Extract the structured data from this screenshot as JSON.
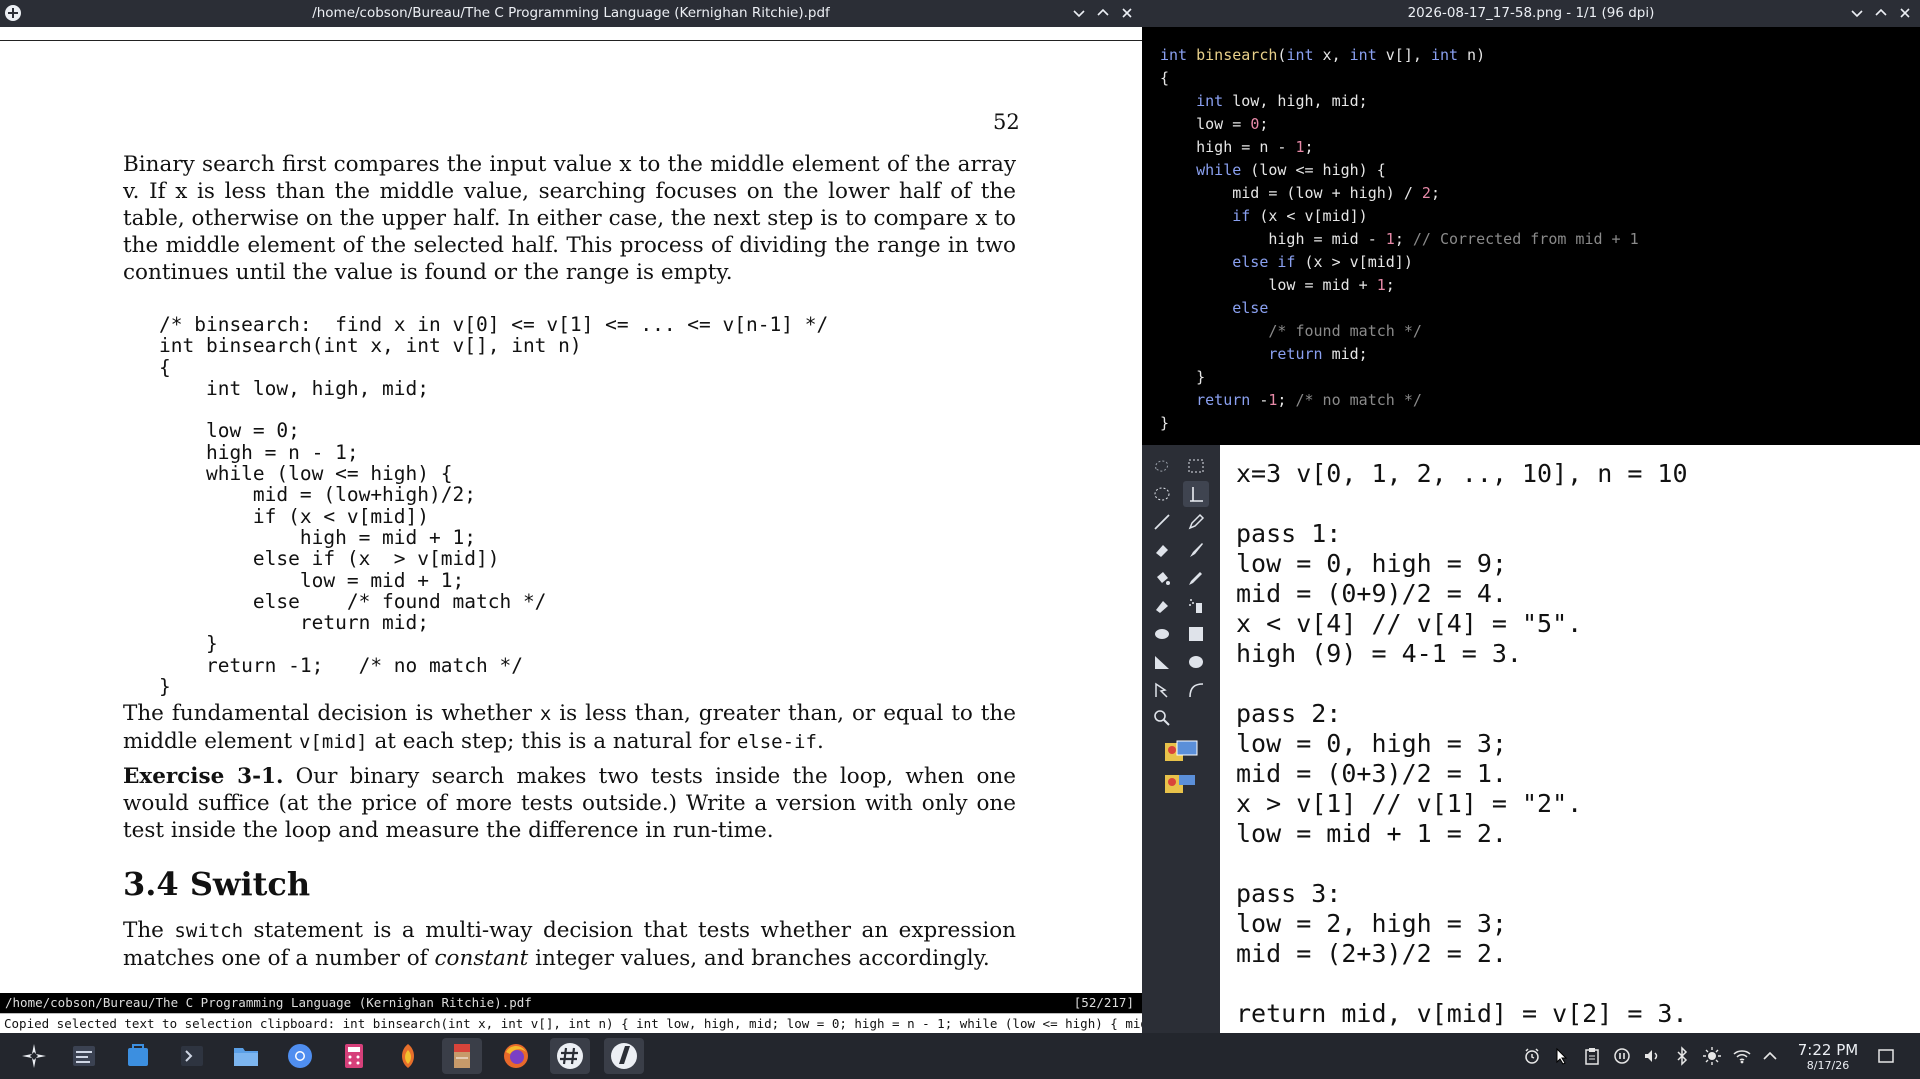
{
  "pdf_window": {
    "title": "/home/cobson/Bureau/The C Programming Language (Kernighan Ritchie).pdf",
    "page_number": "52",
    "para1": "Binary search first compares the input value x to the middle element of the array v. If x is less than the middle value, searching focuses on the lower half of the table, otherwise on the upper half. In either case, the next step is to compare x to the middle element of the selected half. This process of dividing the range in two continues until the value is found or the range is empty.",
    "code": "/* binsearch:  find x in v[0] <= v[1] <= ... <= v[n-1] */\nint binsearch(int x, int v[], int n)\n{\n    int low, high, mid;\n\n    low = 0;\n    high = n - 1;\n    while (low <= high) {\n        mid = (low+high)/2;\n        if (x < v[mid])\n            high = mid + 1;\n        else if (x  > v[mid])\n            low = mid + 1;\n        else    /* found match */\n            return mid;\n    }\n    return -1;   /* no match */\n}",
    "para2_a": "The fundamental decision is whether ",
    "para2_x": "x",
    "para2_b": " is less than, greater than, or equal to the middle element ",
    "para2_vmid": "v[mid]",
    "para2_c": " at each step; this is a natural for ",
    "para2_elseif": "else-if",
    "para2_d": ".",
    "exercise_label": "Exercise 3-1.",
    "exercise_text": " Our binary search makes two tests inside the loop, when one would suffice (at the price of more tests outside.) Write a version with only one test inside the loop and measure the difference in run-time.",
    "section_heading": "3.4 Switch",
    "para4_a": "The ",
    "para4_switch": "switch",
    "para4_b": " statement is a multi-way decision that tests whether an expression matches one of a number of ",
    "para4_constant": "constant",
    "para4_c": " integer values, and branches accordingly.",
    "status_path": "/home/cobson/Bureau/The C Programming Language (Kernighan Ritchie).pdf",
    "status_page": "[52/217]",
    "message": "Copied selected text to selection clipboard: int binsearch(int x, int v[], int n) { int low, high, mid; low = 0; high = n - 1; while (low <= high) { mid = (…"
  },
  "image_window": {
    "title": "2026-08-17_17-58.png - 1/1 (96 dpi)"
  },
  "paint": {
    "canvas_text": "x=3 v[0, 1, 2, .., 10], n = 10\n\npass 1:\nlow = 0, high = 9;\nmid = (0+9)/2 = 4.\nx < v[4] // v[4] = \"5\".\nhigh (9) = 4-1 = 3.\n\npass 2:\nlow = 0, high = 3;\nmid = (0+3)/2 = 1.\nx > v[1] // v[1] = \"2\".\nlow = mid + 1 = 2.\n\npass 3:\nlow = 2, high = 3;\nmid = (2+3)/2 = 2.\n\nreturn mid, v[mid] = v[2] = 3."
  },
  "taskbar": {
    "clock_time": "7:22 PM",
    "clock_date": "8/17/26"
  }
}
